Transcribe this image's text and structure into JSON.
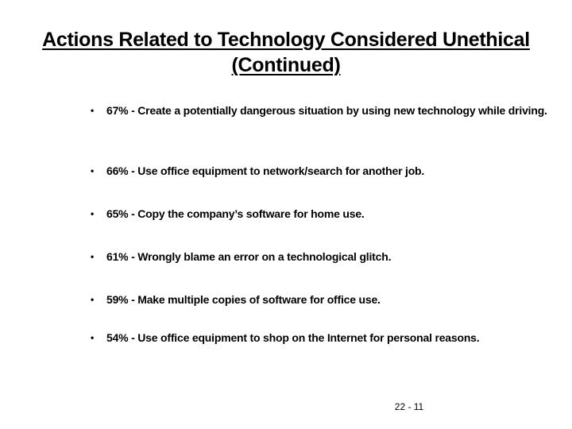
{
  "slide": {
    "title_line1": "Actions Related to Technology Considered Unethical",
    "title_line2": "(Continued)",
    "bullets": [
      {
        "percent": "67%",
        "text": " - Create a potentially dangerous situation by using new technology while driving."
      },
      {
        "percent": "66%",
        "text": " - Use office equipment to network/search for another job."
      },
      {
        "percent": "65%",
        "text": " - Copy the company’s software for home use."
      },
      {
        "percent": "61%",
        "text": " - Wrongly blame an error on a technological glitch."
      },
      {
        "percent": "59%",
        "text": " - Make multiple copies of software for office use."
      },
      {
        "percent": "54%",
        "text": " - Use office equipment to shop on the Internet for personal reasons."
      }
    ],
    "bullet_glyph": "•",
    "page_number": "22 - 11"
  }
}
